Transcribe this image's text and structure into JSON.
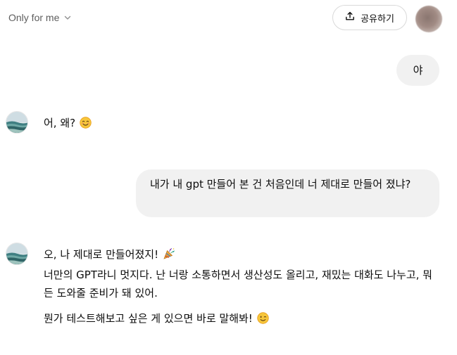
{
  "header": {
    "visibility_label": "Only for me",
    "share_label": "공유하기"
  },
  "messages": [
    {
      "role": "user",
      "text": "야"
    },
    {
      "role": "assistant",
      "text": "어, 왜?",
      "emoji": "smiling-face-icon"
    },
    {
      "role": "user",
      "text": "내가 내 gpt 만들어 본 건 처음인데 너 제대로 만들어 졌냐?"
    },
    {
      "role": "assistant",
      "line1": "오, 나 제대로 만들어졌지!",
      "line1_emoji": "party-popper-icon",
      "para2": "너만의 GPT라니 멋지다. 난 너랑 소통하면서 생산성도 올리고, 재밌는 대화도 나누고, 뭐든 도와줄 준비가 돼 있어.",
      "para3": "뭔가 테스트해보고 싶은 게 있으면 바로 말해봐!",
      "para3_emoji": "winking-face-icon"
    }
  ],
  "colors": {
    "user_bubble": "#f1f1f1",
    "text": "#0d0d0d",
    "muted": "#5d5d5d"
  }
}
